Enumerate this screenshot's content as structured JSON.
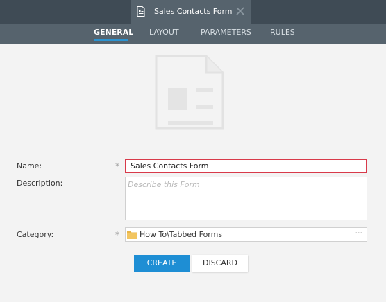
{
  "tab": {
    "title": "Sales Contacts Form",
    "icon": "form-document-icon",
    "close_icon": "close-icon"
  },
  "subtabs": [
    {
      "label": "GENERAL",
      "active": true
    },
    {
      "label": "LAYOUT",
      "active": false
    },
    {
      "label": "PARAMETERS",
      "active": false
    },
    {
      "label": "RULES",
      "active": false
    }
  ],
  "illustration": "form-illustration-icon",
  "fields": {
    "name": {
      "label": "Name:",
      "value": "Sales Contacts Form",
      "required_mark": "*"
    },
    "description": {
      "label": "Description:",
      "placeholder": "Describe this Form",
      "value": ""
    },
    "category": {
      "label": "Category:",
      "value": "How To\\Tabbed Forms",
      "required_mark": "*",
      "button": "···",
      "icon": "folder-icon"
    }
  },
  "buttons": {
    "create": "CREATE",
    "discard": "DISCARD"
  },
  "colors": {
    "accent": "#1e8ed4",
    "error_border": "#d83a4a",
    "header_dark": "#3f4b55",
    "header": "#56636d"
  }
}
